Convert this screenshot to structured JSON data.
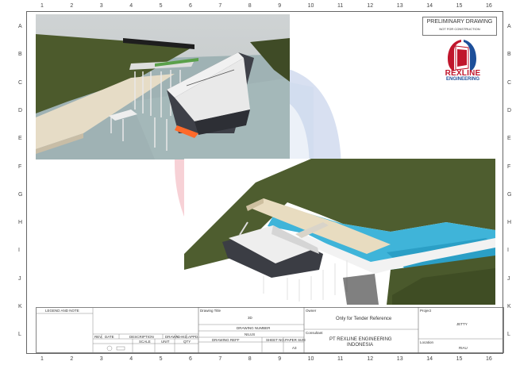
{
  "grid": {
    "columns": [
      "1",
      "2",
      "3",
      "4",
      "5",
      "6",
      "7",
      "8",
      "9",
      "10",
      "11",
      "12",
      "13",
      "14",
      "15",
      "16"
    ],
    "rows": [
      "A",
      "B",
      "C",
      "D",
      "E",
      "F",
      "G",
      "H",
      "I",
      "J",
      "K",
      "L"
    ]
  },
  "stamp": {
    "title": "PRELIMINARY DRAWING",
    "subtitle": "NOT FOR CONSTRUCTION"
  },
  "logo": {
    "name": "REXLINE",
    "sub": "ENGINEERING",
    "colors": {
      "red": "#c0162c",
      "blue": "#1d4f9a"
    }
  },
  "title_block": {
    "legend_label": "LEGEND AND NOTE",
    "rev_headers": [
      "REV.",
      "DATE",
      "DESCRIPTION",
      "DRAWN",
      "CHKD.",
      "APPD."
    ],
    "scale_headers": [
      "SCALE",
      "UNIT",
      "QTY"
    ],
    "drawing_title_label": "Drawing Title",
    "drawing_title_value": "3D",
    "drawing_number_label": "DRAWING NUMBER",
    "drawing_number_value": "NILUS",
    "drawing_ref_label": "DRAWING REFF",
    "sheet_no_label": "SHEET NO.",
    "paper_size_label": "PAPER SIZE",
    "paper_size_value": "A3",
    "owner_label": "Owner",
    "owner_value": "Only for Tender Reference",
    "consultant_label": "Consultant",
    "consultant_line1": "PT REXLINE ENGINEERING",
    "consultant_line2": "INDONESIA",
    "project_label": "Project",
    "project_value": "JETTY",
    "location_label": "Location",
    "location_value": "RIAU"
  },
  "colors": {
    "land": "#4e5d2f",
    "water": "#3fb4d9",
    "deck": "#e8dcc0",
    "barge": "#3e4048"
  }
}
